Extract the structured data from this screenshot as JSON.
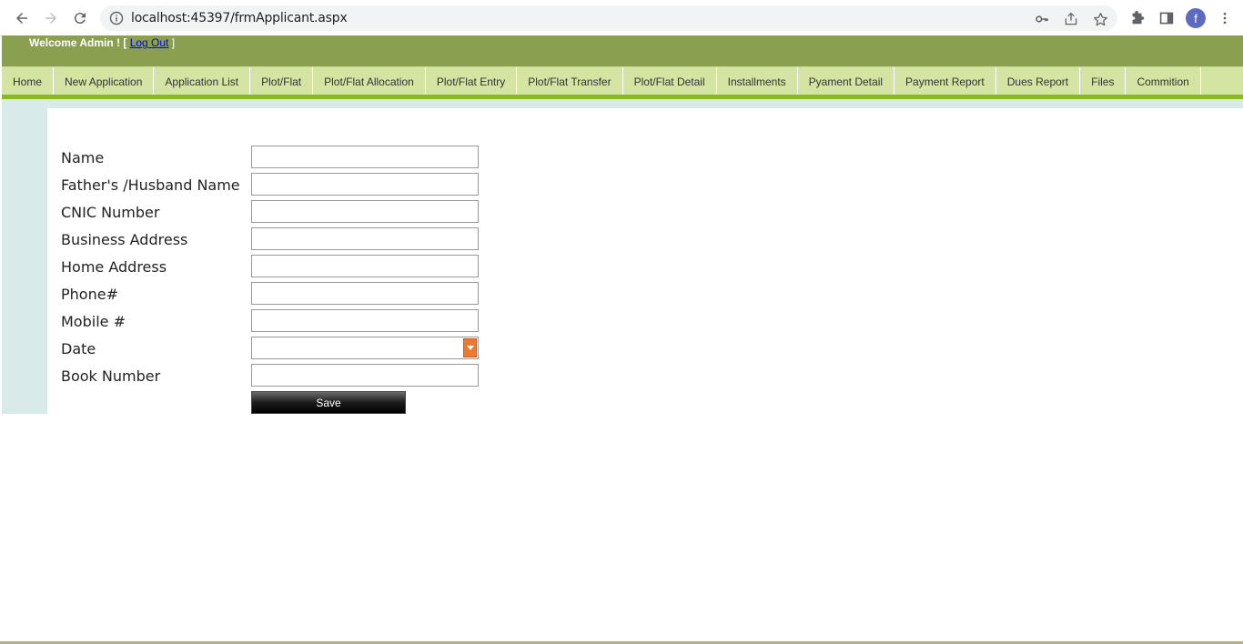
{
  "browser": {
    "url": "localhost:45397/frmApplicant.aspx",
    "profile_initial": "f"
  },
  "header": {
    "welcome_text": "Welcome Admin ! [",
    "logout_label": "Log Out",
    "bracket_close": "]"
  },
  "menu": {
    "items": [
      {
        "label": "Home"
      },
      {
        "label": "New Application"
      },
      {
        "label": "Application List"
      },
      {
        "label": "Plot/Flat"
      },
      {
        "label": "Plot/Flat Allocation"
      },
      {
        "label": "Plot/Flat Entry"
      },
      {
        "label": "Plot/Flat Transfer"
      },
      {
        "label": "Plot/Flat Detail"
      },
      {
        "label": "Installments"
      },
      {
        "label": "Pyament Detail"
      },
      {
        "label": "Payment Report"
      },
      {
        "label": "Dues Report"
      },
      {
        "label": "Files"
      },
      {
        "label": "Commition"
      }
    ],
    "active_index": 1
  },
  "form": {
    "fields": [
      {
        "label": "Name",
        "value": ""
      },
      {
        "label": "Father's /Husband Name",
        "value": ""
      },
      {
        "label": "CNIC Number",
        "value": ""
      },
      {
        "label": "Business Address",
        "value": ""
      },
      {
        "label": "Home Address",
        "value": ""
      },
      {
        "label": "Phone#",
        "value": ""
      },
      {
        "label": "Mobile #",
        "value": ""
      },
      {
        "label": "Date",
        "value": ""
      },
      {
        "label": "Book Number",
        "value": ""
      }
    ],
    "save_label": "Save"
  },
  "colors": {
    "header_bg": "#8aa050",
    "menu_bg": "#d4e4a2",
    "active_accent": "#e8873a",
    "menu_underline": "#8ab820"
  }
}
